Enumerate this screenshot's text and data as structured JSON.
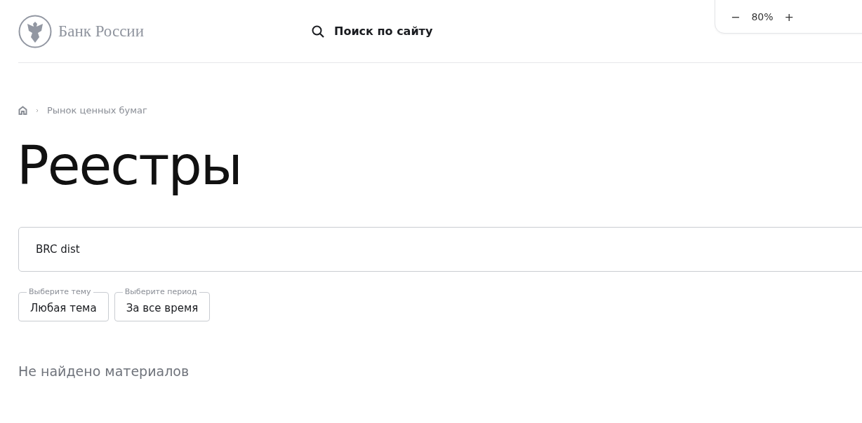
{
  "header": {
    "logo_text": "Банк России",
    "search_label": "Поиск по сайту"
  },
  "zoom": {
    "minus": "−",
    "value": "80%",
    "plus": "+"
  },
  "breadcrumbs": [
    {
      "label": "Рынок ценных бумаг"
    }
  ],
  "title": "Реестры",
  "search": {
    "value": "BRC dist"
  },
  "filters": [
    {
      "label": "Выберите тему",
      "value": "Любая тема"
    },
    {
      "label": "Выберите период",
      "value": "За все время"
    }
  ],
  "message": "Не найдено материалов"
}
